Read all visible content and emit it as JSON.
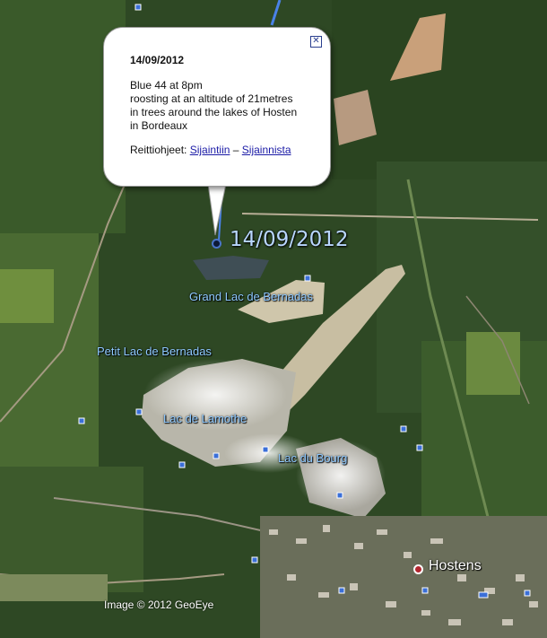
{
  "popup": {
    "title": "14/09/2012",
    "body": "Blue 44 at 8pm\nroosting at an altitude of 21metres\nin trees around the lakes of Hosten\nin Bordeaux",
    "directions_prefix": "Reittiohjeet:",
    "directions_to": "Sijaintiin",
    "directions_sep": "–",
    "directions_from": "Sijainnista",
    "close_icon": "close-icon"
  },
  "track_point": {
    "label": "14/09/2012"
  },
  "lakes": [
    {
      "name": "Grand Lac de Bernadas"
    },
    {
      "name": "Petit Lac de Bernadas"
    },
    {
      "name": "Lac de Lamothe"
    },
    {
      "name": "Lac du Bourg"
    }
  ],
  "town": {
    "name": "Hostens"
  },
  "copyright": "Image © 2012 GeoEye",
  "colors": {
    "track_line": "#4a82e8",
    "label_blue": "#8ec9ff",
    "forest": "#2f4a22",
    "lake": "#c9c2a8"
  }
}
